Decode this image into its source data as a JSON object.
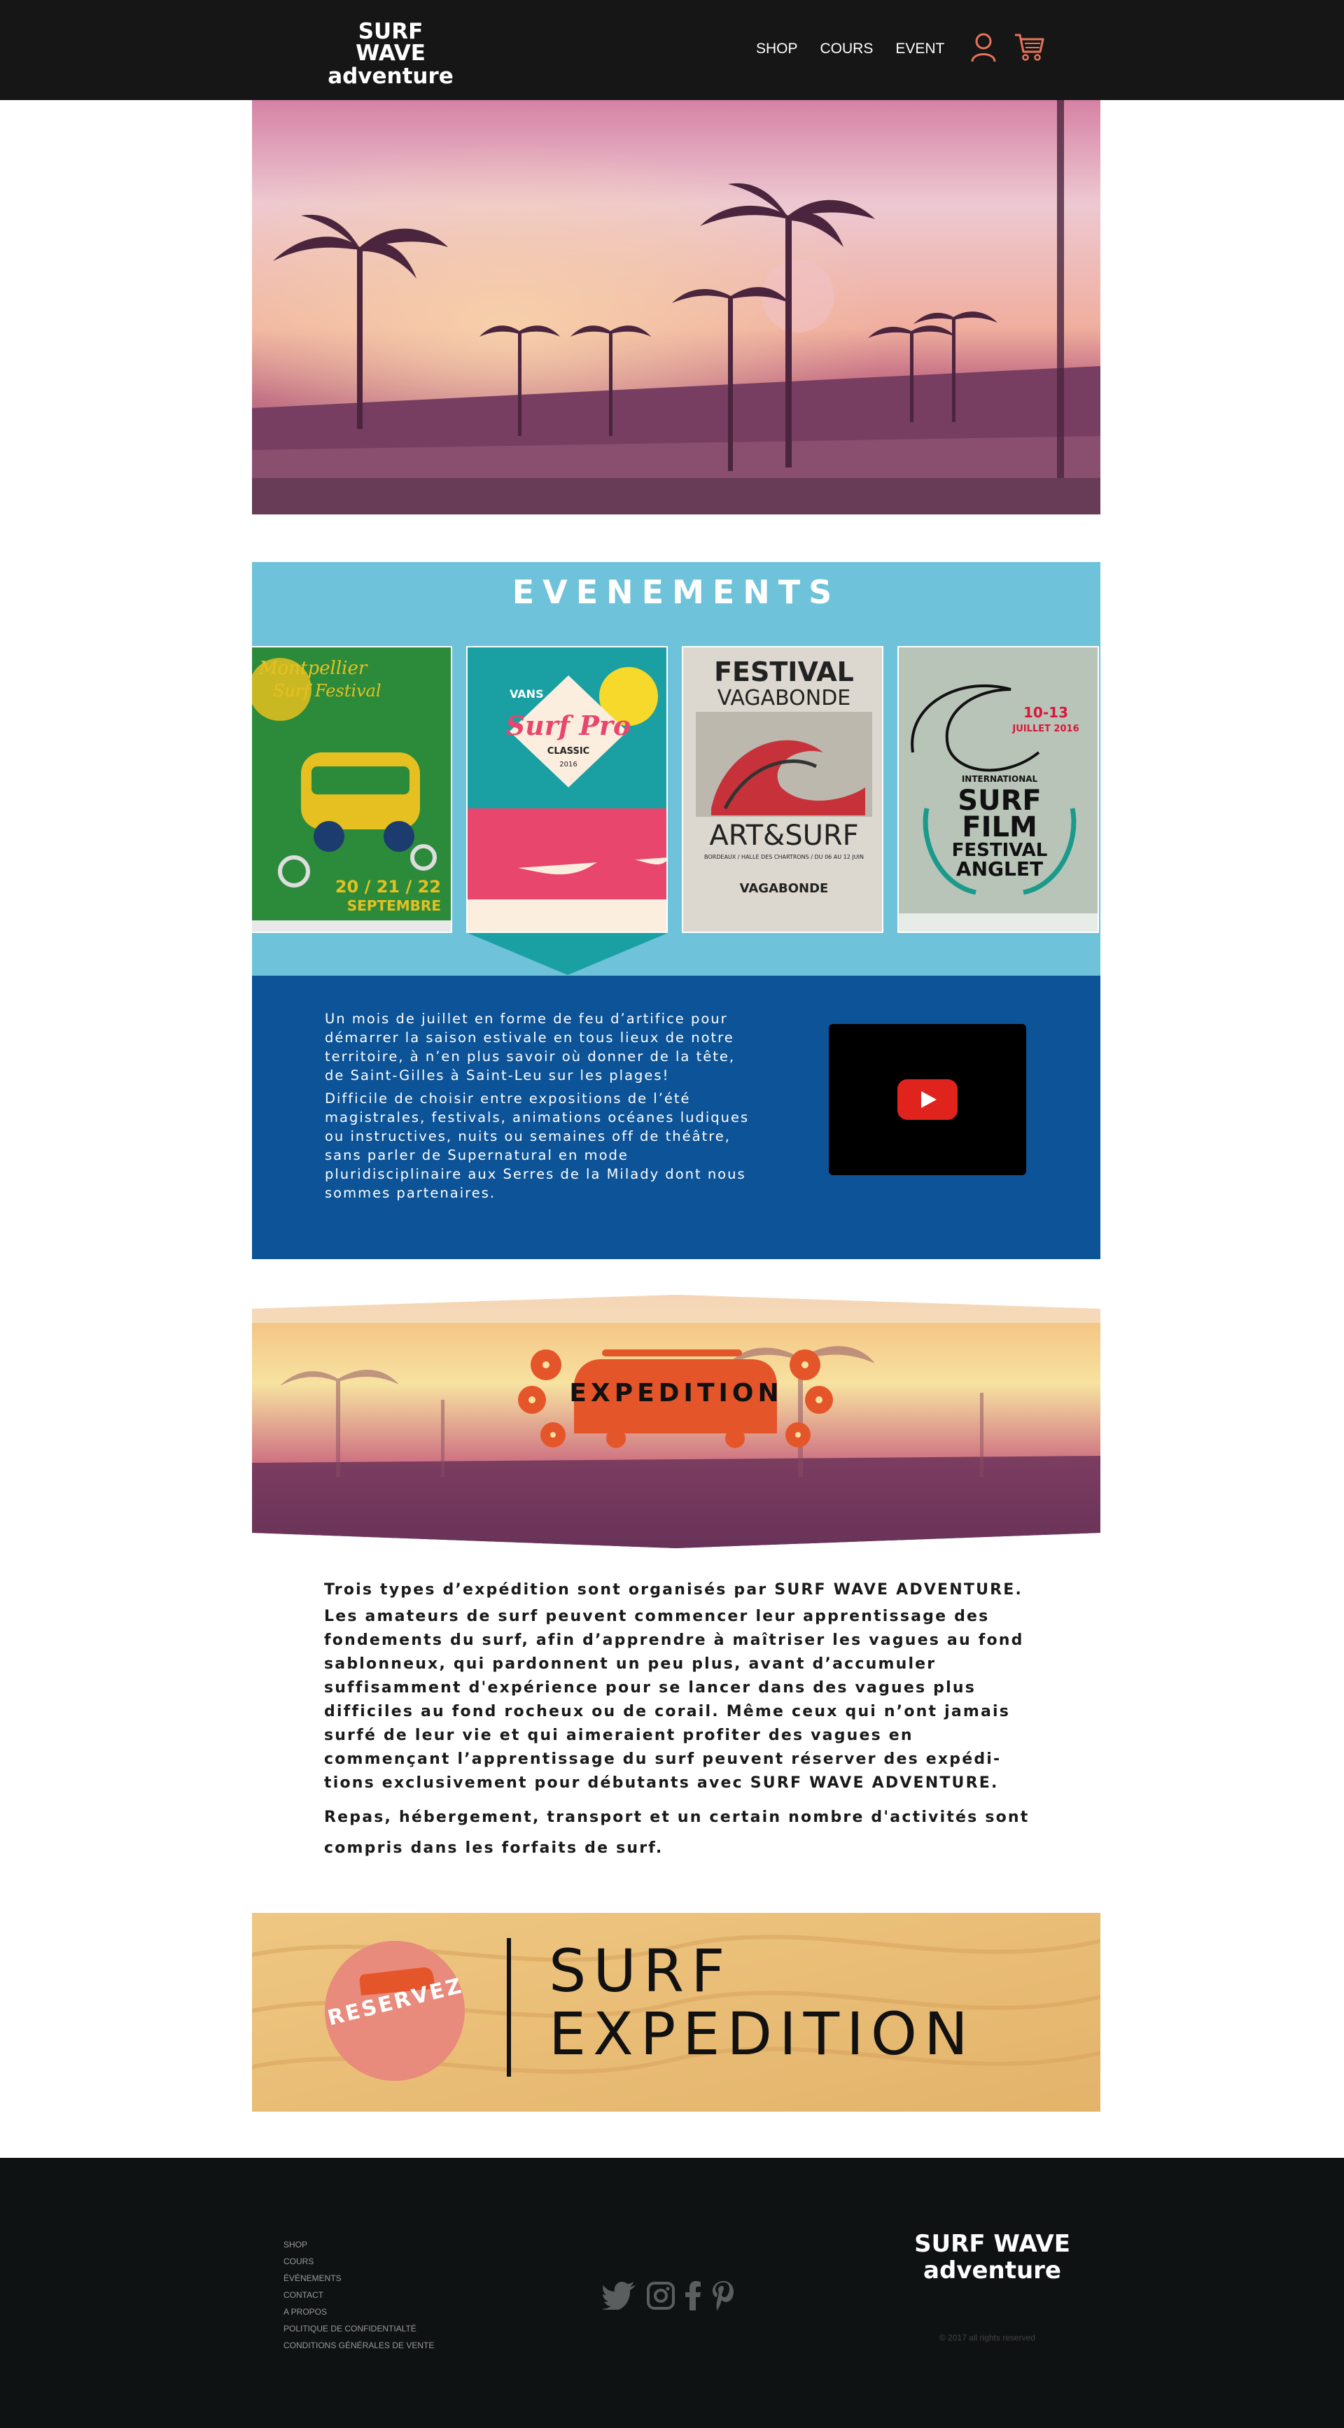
{
  "header": {
    "logo": {
      "line1": "SURF WAVE",
      "line2": "adventure"
    },
    "nav": [
      "SHOP",
      "COURS",
      "EVENT"
    ],
    "icons": [
      "user-icon",
      "cart-icon"
    ],
    "accent": "#e8745a"
  },
  "hero": {
    "image": "sunset-palm-beach-photo"
  },
  "events": {
    "title": "EVENEMENTS",
    "background": "#6ec2d9",
    "posters": [
      {
        "name": "montpellier-surf-festival-poster",
        "text": [
          "Montpellier",
          "Surf Festival",
          "20 / 21 / 22",
          "SEPTEMBRE"
        ]
      },
      {
        "name": "vans-surf-pro-classic-poster",
        "text": [
          "VANS",
          "Surf Pro",
          "CLASSIC",
          "2016"
        ]
      },
      {
        "name": "festival-vagabonde-poster",
        "text": [
          "FESTIVAL",
          "VAGABONDE",
          "ART&SURF",
          "BORDEAUX / HALLE DES CHARTRONS / DU 06 AU 12 JUIN",
          "VAGABONDE"
        ]
      },
      {
        "name": "surf-film-festival-anglet-poster",
        "text": [
          "10-13",
          "JUILLET 2016",
          "INTERNATIONAL",
          "SURF",
          "FILM",
          "FESTIVAL",
          "ANGLET"
        ]
      }
    ],
    "info": {
      "paragraphs": [
        "Un mois de juillet en forme de feu d’artifice pour démarrer la saison estivale en tous lieux de notre territoire, à n’en plus savoir où donner de la tête, de Saint-Gilles à Saint-Leu sur les plages!",
        "Difficile de choisir entre expositions de l’été magistrales, festivals, animations océanes ludiques ou instructives, nuits ou semaines off de théâtre, sans parler de Supernatural en mode pluridisciplinaire aux Serres de la Milady dont nous sommes partenaires."
      ],
      "background": "#0c5397",
      "video": "youtube-play-icon"
    }
  },
  "expedition": {
    "title": "EXPEDITION",
    "paragraphs": [
      "Trois types d’expédition sont organisés par SURF WAVE ADVENTURE.",
      "Les amateurs de surf peuvent commencer leur apprentissage des fondements du surf, afin d’apprendre à maîtriser les vagues au fond sablonneux, qui pardonnent un peu plus, avant d’accumuler suffisamment d'expérience pour se lancer dans des vagues plus difficiles au fond rocheux ou de corail. Même ceux qui n’ont jamais surfé de leur vie et qui aimeraient profiter des vagues en commençant l’apprentissage du surf peuvent réserver des expédi-tions exclusivement pour débutants avec SURF WAVE ADVENTURE.",
      "Repas, hébergement, transport et un certain nombre d'activités sont compris dans les forfaits de surf."
    ]
  },
  "reserve": {
    "button": "RESERVEZ",
    "title_line1": "SURF",
    "title_line2": "EXPEDITION"
  },
  "footer": {
    "links": [
      "SHOP",
      "COURS",
      "ÉVÉNEMENTS",
      "CONTACT",
      "A PROPOS",
      "POLITIQUE DE CONFIDENTIALTÉ",
      "CONDITIONS GÉNÉRALES DE VENTE"
    ],
    "social": [
      "twitter-icon",
      "instagram-icon",
      "facebook-icon",
      "pinterest-icon"
    ],
    "logo": {
      "line1": "SURF WAVE",
      "line2": "adventure"
    },
    "copyright": "© 2017 all rights reserved"
  }
}
